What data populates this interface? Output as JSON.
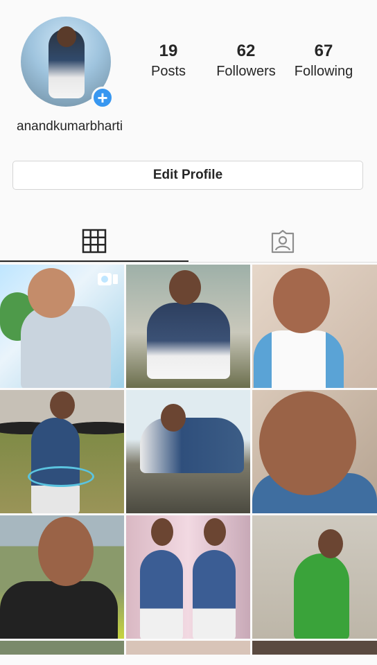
{
  "profile": {
    "username": "anandkumarbharti",
    "add_icon": "plus-icon",
    "stats": [
      {
        "count": "19",
        "label": "Posts"
      },
      {
        "count": "62",
        "label": "Followers"
      },
      {
        "count": "67",
        "label": "Following"
      }
    ],
    "edit_label": "Edit Profile"
  },
  "tabs": [
    {
      "name": "grid-icon",
      "active": true
    },
    {
      "name": "tagged-icon",
      "active": false
    }
  ],
  "colors": {
    "accent": "#3897f0",
    "text": "#262626",
    "background": "#fafafa"
  }
}
